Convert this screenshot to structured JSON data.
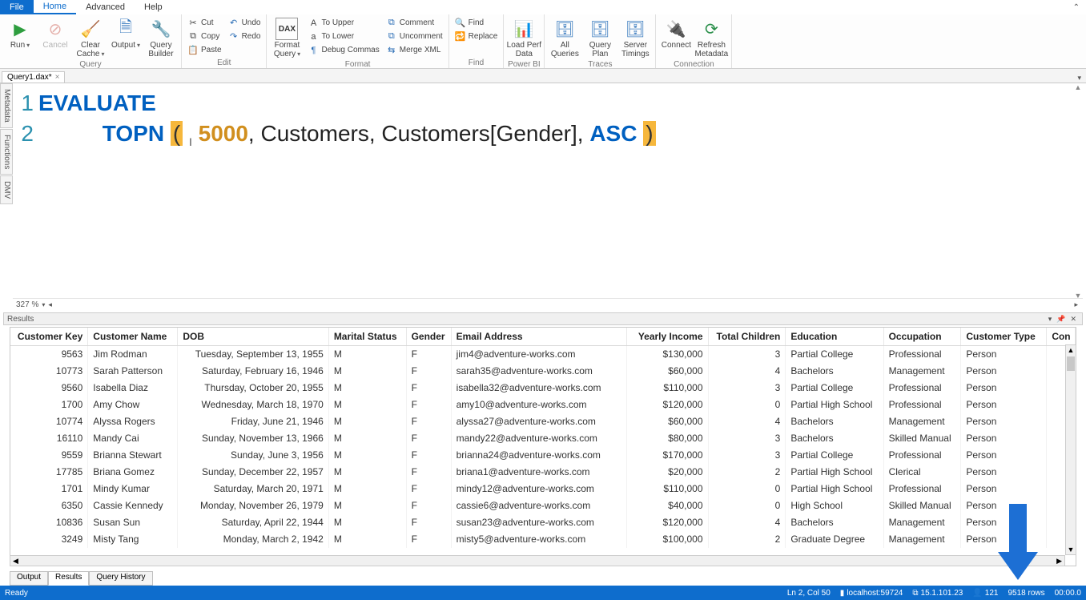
{
  "menu": {
    "file": "File",
    "home": "Home",
    "advanced": "Advanced",
    "help": "Help"
  },
  "ribbon": {
    "query": {
      "label": "Query",
      "run": "Run",
      "cancel": "Cancel",
      "clear_cache": "Clear\nCache",
      "output": "Output",
      "query_builder": "Query\nBuilder"
    },
    "edit": {
      "label": "Edit",
      "cut": "Cut",
      "copy": "Copy",
      "paste": "Paste",
      "undo": "Undo",
      "redo": "Redo"
    },
    "format": {
      "label": "Format",
      "format_query": "Format\nQuery",
      "to_upper": "To Upper",
      "to_lower": "To Lower",
      "debug_commas": "Debug Commas",
      "comment": "Comment",
      "uncomment": "Uncomment",
      "merge_xml": "Merge XML"
    },
    "find": {
      "label": "Find",
      "find": "Find",
      "replace": "Replace"
    },
    "powerbi": {
      "label": "Power BI",
      "load_perf": "Load Perf\nData"
    },
    "traces": {
      "label": "Traces",
      "all_queries": "All\nQueries",
      "query_plan": "Query\nPlan",
      "server_timings": "Server\nTimings"
    },
    "connection": {
      "label": "Connection",
      "connect": "Connect",
      "refresh": "Refresh\nMetadata"
    }
  },
  "doc_tab": {
    "name": "Query1.dax*",
    "close": "×"
  },
  "side": {
    "metadata": "Metadata",
    "functions": "Functions",
    "dmv": "DMV"
  },
  "code": {
    "line1_kw": "EVALUATE",
    "line2_fn": "TOPN",
    "line2_num": "5000",
    "line2_tbl": "Customers",
    "line2_col": "Customers[Gender]",
    "line2_ord": "ASC"
  },
  "zoom": "327 %",
  "results_label": "Results",
  "columns": [
    "Customer Key",
    "Customer Name",
    "DOB",
    "Marital Status",
    "Gender",
    "Email Address",
    "Yearly Income",
    "Total Children",
    "Education",
    "Occupation",
    "Customer Type",
    "Con"
  ],
  "rows": [
    {
      "key": "9563",
      "name": "Jim Rodman",
      "dob": "Tuesday, September 13, 1955",
      "ms": "M",
      "g": "F",
      "email": "jim4@adventure-works.com",
      "inc": "$130,000",
      "ch": "3",
      "edu": "Partial College",
      "occ": "Professional",
      "ct": "Person"
    },
    {
      "key": "10773",
      "name": "Sarah Patterson",
      "dob": "Saturday, February 16, 1946",
      "ms": "M",
      "g": "F",
      "email": "sarah35@adventure-works.com",
      "inc": "$60,000",
      "ch": "4",
      "edu": "Bachelors",
      "occ": "Management",
      "ct": "Person"
    },
    {
      "key": "9560",
      "name": "Isabella Diaz",
      "dob": "Thursday, October 20, 1955",
      "ms": "M",
      "g": "F",
      "email": "isabella32@adventure-works.com",
      "inc": "$110,000",
      "ch": "3",
      "edu": "Partial College",
      "occ": "Professional",
      "ct": "Person"
    },
    {
      "key": "1700",
      "name": "Amy Chow",
      "dob": "Wednesday, March 18, 1970",
      "ms": "M",
      "g": "F",
      "email": "amy10@adventure-works.com",
      "inc": "$120,000",
      "ch": "0",
      "edu": "Partial High School",
      "occ": "Professional",
      "ct": "Person"
    },
    {
      "key": "10774",
      "name": "Alyssa Rogers",
      "dob": "Friday, June 21, 1946",
      "ms": "M",
      "g": "F",
      "email": "alyssa27@adventure-works.com",
      "inc": "$60,000",
      "ch": "4",
      "edu": "Bachelors",
      "occ": "Management",
      "ct": "Person"
    },
    {
      "key": "16110",
      "name": "Mandy Cai",
      "dob": "Sunday, November 13, 1966",
      "ms": "M",
      "g": "F",
      "email": "mandy22@adventure-works.com",
      "inc": "$80,000",
      "ch": "3",
      "edu": "Bachelors",
      "occ": "Skilled Manual",
      "ct": "Person"
    },
    {
      "key": "9559",
      "name": "Brianna Stewart",
      "dob": "Sunday, June 3, 1956",
      "ms": "M",
      "g": "F",
      "email": "brianna24@adventure-works.com",
      "inc": "$170,000",
      "ch": "3",
      "edu": "Partial College",
      "occ": "Professional",
      "ct": "Person"
    },
    {
      "key": "17785",
      "name": "Briana Gomez",
      "dob": "Sunday, December 22, 1957",
      "ms": "M",
      "g": "F",
      "email": "briana1@adventure-works.com",
      "inc": "$20,000",
      "ch": "2",
      "edu": "Partial High School",
      "occ": "Clerical",
      "ct": "Person"
    },
    {
      "key": "1701",
      "name": "Mindy Kumar",
      "dob": "Saturday, March 20, 1971",
      "ms": "M",
      "g": "F",
      "email": "mindy12@adventure-works.com",
      "inc": "$110,000",
      "ch": "0",
      "edu": "Partial High School",
      "occ": "Professional",
      "ct": "Person"
    },
    {
      "key": "6350",
      "name": "Cassie Kennedy",
      "dob": "Monday, November 26, 1979",
      "ms": "M",
      "g": "F",
      "email": "cassie6@adventure-works.com",
      "inc": "$40,000",
      "ch": "0",
      "edu": "High School",
      "occ": "Skilled Manual",
      "ct": "Person"
    },
    {
      "key": "10836",
      "name": "Susan Sun",
      "dob": "Saturday, April 22, 1944",
      "ms": "M",
      "g": "F",
      "email": "susan23@adventure-works.com",
      "inc": "$120,000",
      "ch": "4",
      "edu": "Bachelors",
      "occ": "Management",
      "ct": "Person"
    },
    {
      "key": "3249",
      "name": "Misty Tang",
      "dob": "Monday, March 2, 1942",
      "ms": "M",
      "g": "F",
      "email": "misty5@adventure-works.com",
      "inc": "$100,000",
      "ch": "2",
      "edu": "Graduate Degree",
      "occ": "Management",
      "ct": "Person"
    }
  ],
  "bottom_tabs": {
    "output": "Output",
    "results": "Results",
    "history": "Query History"
  },
  "status": {
    "ready": "Ready",
    "pos": "Ln 2, Col 50",
    "host": "localhost:59724",
    "ver": "15.1.101.23",
    "spid": "121",
    "rows": "9518 rows",
    "time": "00:00.0"
  }
}
